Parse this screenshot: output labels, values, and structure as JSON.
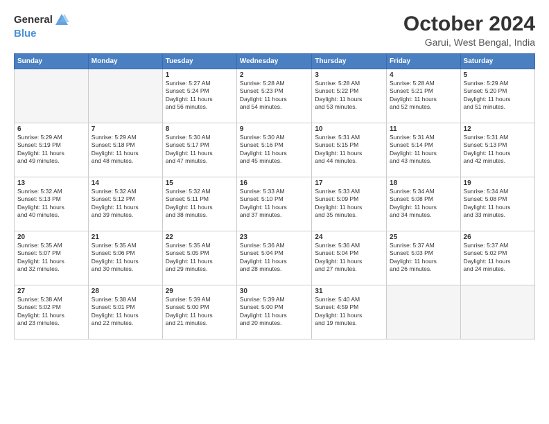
{
  "logo": {
    "general": "General",
    "blue": "Blue"
  },
  "title": "October 2024",
  "location": "Garui, West Bengal, India",
  "headers": [
    "Sunday",
    "Monday",
    "Tuesday",
    "Wednesday",
    "Thursday",
    "Friday",
    "Saturday"
  ],
  "weeks": [
    [
      {
        "day": "",
        "sunrise": "",
        "sunset": "",
        "daylight": ""
      },
      {
        "day": "",
        "sunrise": "",
        "sunset": "",
        "daylight": ""
      },
      {
        "day": "1",
        "sunrise": "Sunrise: 5:27 AM",
        "sunset": "Sunset: 5:24 PM",
        "daylight": "Daylight: 11 hours and 56 minutes."
      },
      {
        "day": "2",
        "sunrise": "Sunrise: 5:28 AM",
        "sunset": "Sunset: 5:23 PM",
        "daylight": "Daylight: 11 hours and 54 minutes."
      },
      {
        "day": "3",
        "sunrise": "Sunrise: 5:28 AM",
        "sunset": "Sunset: 5:22 PM",
        "daylight": "Daylight: 11 hours and 53 minutes."
      },
      {
        "day": "4",
        "sunrise": "Sunrise: 5:28 AM",
        "sunset": "Sunset: 5:21 PM",
        "daylight": "Daylight: 11 hours and 52 minutes."
      },
      {
        "day": "5",
        "sunrise": "Sunrise: 5:29 AM",
        "sunset": "Sunset: 5:20 PM",
        "daylight": "Daylight: 11 hours and 51 minutes."
      }
    ],
    [
      {
        "day": "6",
        "sunrise": "Sunrise: 5:29 AM",
        "sunset": "Sunset: 5:19 PM",
        "daylight": "Daylight: 11 hours and 49 minutes."
      },
      {
        "day": "7",
        "sunrise": "Sunrise: 5:29 AM",
        "sunset": "Sunset: 5:18 PM",
        "daylight": "Daylight: 11 hours and 48 minutes."
      },
      {
        "day": "8",
        "sunrise": "Sunrise: 5:30 AM",
        "sunset": "Sunset: 5:17 PM",
        "daylight": "Daylight: 11 hours and 47 minutes."
      },
      {
        "day": "9",
        "sunrise": "Sunrise: 5:30 AM",
        "sunset": "Sunset: 5:16 PM",
        "daylight": "Daylight: 11 hours and 45 minutes."
      },
      {
        "day": "10",
        "sunrise": "Sunrise: 5:31 AM",
        "sunset": "Sunset: 5:15 PM",
        "daylight": "Daylight: 11 hours and 44 minutes."
      },
      {
        "day": "11",
        "sunrise": "Sunrise: 5:31 AM",
        "sunset": "Sunset: 5:14 PM",
        "daylight": "Daylight: 11 hours and 43 minutes."
      },
      {
        "day": "12",
        "sunrise": "Sunrise: 5:31 AM",
        "sunset": "Sunset: 5:13 PM",
        "daylight": "Daylight: 11 hours and 42 minutes."
      }
    ],
    [
      {
        "day": "13",
        "sunrise": "Sunrise: 5:32 AM",
        "sunset": "Sunset: 5:13 PM",
        "daylight": "Daylight: 11 hours and 40 minutes."
      },
      {
        "day": "14",
        "sunrise": "Sunrise: 5:32 AM",
        "sunset": "Sunset: 5:12 PM",
        "daylight": "Daylight: 11 hours and 39 minutes."
      },
      {
        "day": "15",
        "sunrise": "Sunrise: 5:32 AM",
        "sunset": "Sunset: 5:11 PM",
        "daylight": "Daylight: 11 hours and 38 minutes."
      },
      {
        "day": "16",
        "sunrise": "Sunrise: 5:33 AM",
        "sunset": "Sunset: 5:10 PM",
        "daylight": "Daylight: 11 hours and 37 minutes."
      },
      {
        "day": "17",
        "sunrise": "Sunrise: 5:33 AM",
        "sunset": "Sunset: 5:09 PM",
        "daylight": "Daylight: 11 hours and 35 minutes."
      },
      {
        "day": "18",
        "sunrise": "Sunrise: 5:34 AM",
        "sunset": "Sunset: 5:08 PM",
        "daylight": "Daylight: 11 hours and 34 minutes."
      },
      {
        "day": "19",
        "sunrise": "Sunrise: 5:34 AM",
        "sunset": "Sunset: 5:08 PM",
        "daylight": "Daylight: 11 hours and 33 minutes."
      }
    ],
    [
      {
        "day": "20",
        "sunrise": "Sunrise: 5:35 AM",
        "sunset": "Sunset: 5:07 PM",
        "daylight": "Daylight: 11 hours and 32 minutes."
      },
      {
        "day": "21",
        "sunrise": "Sunrise: 5:35 AM",
        "sunset": "Sunset: 5:06 PM",
        "daylight": "Daylight: 11 hours and 30 minutes."
      },
      {
        "day": "22",
        "sunrise": "Sunrise: 5:35 AM",
        "sunset": "Sunset: 5:05 PM",
        "daylight": "Daylight: 11 hours and 29 minutes."
      },
      {
        "day": "23",
        "sunrise": "Sunrise: 5:36 AM",
        "sunset": "Sunset: 5:04 PM",
        "daylight": "Daylight: 11 hours and 28 minutes."
      },
      {
        "day": "24",
        "sunrise": "Sunrise: 5:36 AM",
        "sunset": "Sunset: 5:04 PM",
        "daylight": "Daylight: 11 hours and 27 minutes."
      },
      {
        "day": "25",
        "sunrise": "Sunrise: 5:37 AM",
        "sunset": "Sunset: 5:03 PM",
        "daylight": "Daylight: 11 hours and 26 minutes."
      },
      {
        "day": "26",
        "sunrise": "Sunrise: 5:37 AM",
        "sunset": "Sunset: 5:02 PM",
        "daylight": "Daylight: 11 hours and 24 minutes."
      }
    ],
    [
      {
        "day": "27",
        "sunrise": "Sunrise: 5:38 AM",
        "sunset": "Sunset: 5:02 PM",
        "daylight": "Daylight: 11 hours and 23 minutes."
      },
      {
        "day": "28",
        "sunrise": "Sunrise: 5:38 AM",
        "sunset": "Sunset: 5:01 PM",
        "daylight": "Daylight: 11 hours and 22 minutes."
      },
      {
        "day": "29",
        "sunrise": "Sunrise: 5:39 AM",
        "sunset": "Sunset: 5:00 PM",
        "daylight": "Daylight: 11 hours and 21 minutes."
      },
      {
        "day": "30",
        "sunrise": "Sunrise: 5:39 AM",
        "sunset": "Sunset: 5:00 PM",
        "daylight": "Daylight: 11 hours and 20 minutes."
      },
      {
        "day": "31",
        "sunrise": "Sunrise: 5:40 AM",
        "sunset": "Sunset: 4:59 PM",
        "daylight": "Daylight: 11 hours and 19 minutes."
      },
      {
        "day": "",
        "sunrise": "",
        "sunset": "",
        "daylight": ""
      },
      {
        "day": "",
        "sunrise": "",
        "sunset": "",
        "daylight": ""
      }
    ]
  ]
}
